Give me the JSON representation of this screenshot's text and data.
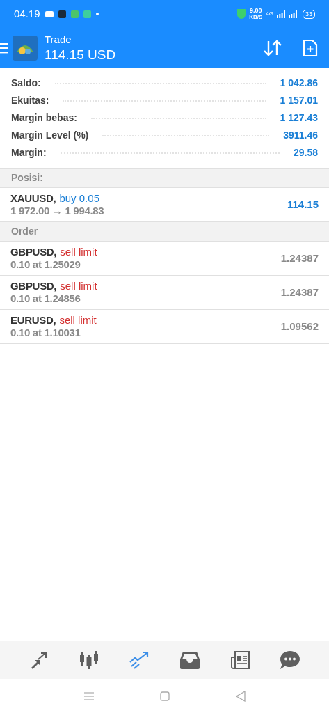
{
  "status_bar": {
    "time": "04.19",
    "speed": "9.00",
    "speed_unit": "KB/S",
    "network": "4G",
    "battery": "33"
  },
  "header": {
    "title": "Trade",
    "balance": "114.15 USD"
  },
  "summary": [
    {
      "label": "Saldo:",
      "value": "1 042.86"
    },
    {
      "label": "Ekuitas:",
      "value": "1 157.01"
    },
    {
      "label": "Margin bebas:",
      "value": "1 127.43"
    },
    {
      "label": "Margin Level (%)",
      "value": "3911.46"
    },
    {
      "label": "Margin:",
      "value": "29.58"
    }
  ],
  "positions": {
    "heading": "Posisi:",
    "items": [
      {
        "symbol": "XAUUSD,",
        "kind": "buy",
        "action": "buy 0.05",
        "detail": "1 972.00 → 1 994.83",
        "value": "114.15"
      }
    ]
  },
  "orders": {
    "heading": "Order",
    "items": [
      {
        "symbol": "GBPUSD,",
        "kind": "sell",
        "action": "sell limit",
        "detail": "0.10 at 1.25029",
        "value": "1.24387"
      },
      {
        "symbol": "GBPUSD,",
        "kind": "sell",
        "action": "sell limit",
        "detail": "0.10 at 1.24856",
        "value": "1.24387"
      },
      {
        "symbol": "EURUSD,",
        "kind": "sell",
        "action": "sell limit",
        "detail": "0.10 at 1.10031",
        "value": "1.09562"
      }
    ]
  },
  "bottom_nav": [
    {
      "kind": "quotes",
      "selected": false
    },
    {
      "kind": "chart",
      "selected": false
    },
    {
      "kind": "trade",
      "selected": true
    },
    {
      "kind": "history",
      "selected": false
    },
    {
      "kind": "news",
      "selected": false
    },
    {
      "kind": "chat",
      "selected": false
    }
  ]
}
